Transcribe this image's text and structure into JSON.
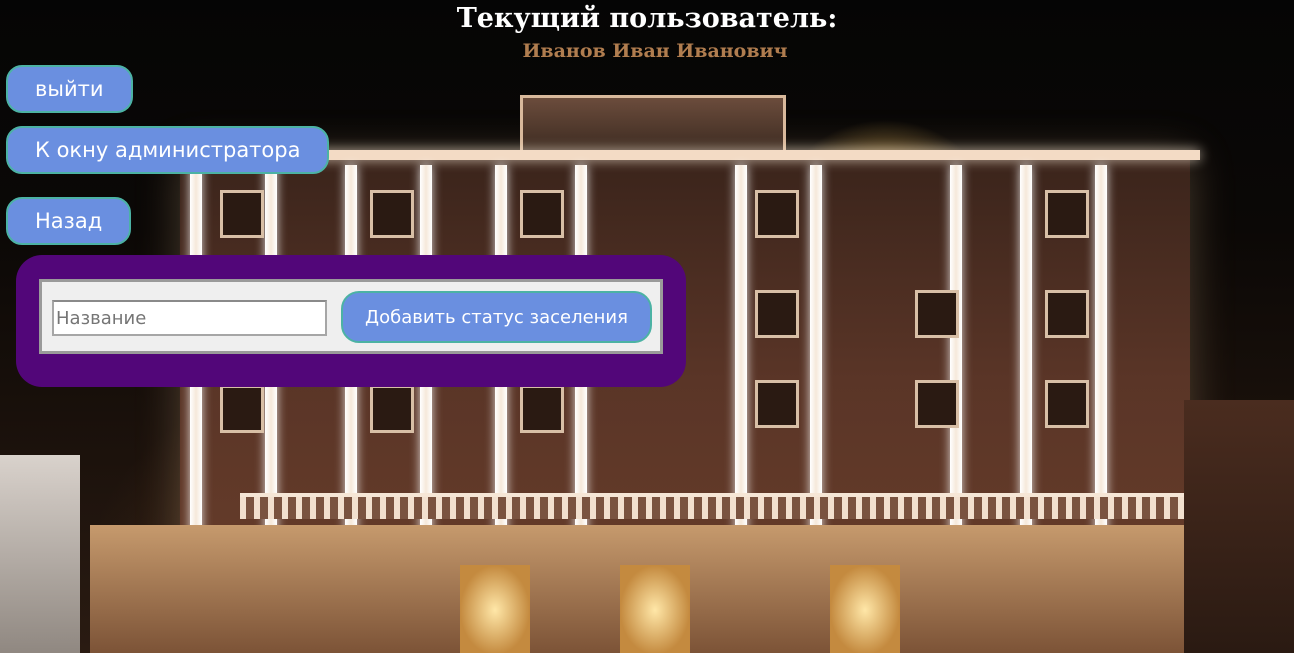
{
  "header": {
    "title": "Текущий пользователь:",
    "user_name": "Иванов Иван Иванович"
  },
  "nav": {
    "logout_label": "выйти",
    "admin_label": "К окну администратора",
    "back_label": "Назад"
  },
  "form": {
    "name_placeholder": "Название",
    "name_value": "",
    "add_button_label": "Добавить статус заселения"
  },
  "background": {
    "image": "night-hotel-facade"
  },
  "colors": {
    "button_bg": "#6a8fe0",
    "button_border": "#4cb2a4",
    "panel_bg": "#520679",
    "user_name": "#b07d4f"
  }
}
